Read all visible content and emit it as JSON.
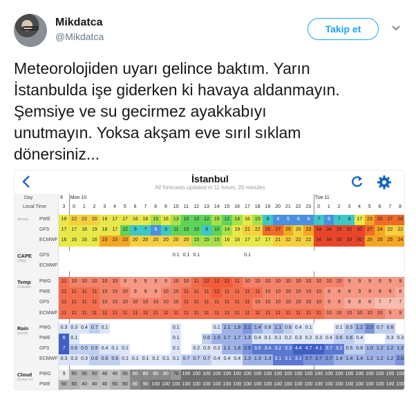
{
  "user": {
    "name": "Mikdatca",
    "handle": "@Mikdatca"
  },
  "follow_label": "Takip et",
  "tweet_lines": [
    "Meteorolojiden uyarı gelince baktım. Yarın",
    "İstanbulda işe giderken ki havaya aldanmayın.",
    "Şemsiye ve su gecirmez ayakkabıyı",
    "unutmayın. Yoksa akşam eve sırıl sıklam",
    "dönersiniz..."
  ],
  "forecast": {
    "title": "İstanbul",
    "subtitle": "All forecasts updated in 11 hours, 20 minutes",
    "day_label": "Day",
    "time_label": "Local Time",
    "days": [
      {
        "col": 0,
        "label": "9"
      },
      {
        "col": 1,
        "label": "Mon 10"
      },
      {
        "col": 25,
        "label": "Tue 11"
      }
    ],
    "hours": [
      "3",
      "0",
      "1",
      "2",
      "3",
      "4",
      "5",
      "6",
      "7",
      "8",
      "9",
      "10",
      "11",
      "12",
      "13",
      "14",
      "15",
      "16",
      "17",
      "18",
      "19",
      "20",
      "21",
      "22",
      "23",
      "0",
      "1",
      "2",
      "3",
      "4",
      "5",
      "6",
      "7",
      "8"
    ],
    "groups": [
      {
        "name": "",
        "unit": "(Knots)",
        "models": [
          "PWE",
          "GFS",
          "ECMWF"
        ]
      },
      {
        "name": "CAPE",
        "unit": "(J/kg)",
        "models": [
          "GFS",
          "ECMWF"
        ]
      },
      {
        "name": "Temp",
        "unit": "(Celsius)",
        "models": [
          "PWG",
          "PWE",
          "GFS",
          "ECMWF"
        ]
      },
      {
        "name": "Rain",
        "unit": "(mm/h)",
        "models": [
          "PWG",
          "PWE",
          "GFS",
          "ECMWF"
        ]
      },
      {
        "name": "Cloud",
        "unit": "(Cover %)",
        "models": [
          "PWG",
          "PWE",
          "GFS",
          "ECMWF"
        ]
      }
    ],
    "rows": {
      "wind_pwe": [
        "19",
        "22",
        "22",
        "20",
        "19",
        "17",
        "17",
        "16",
        "16",
        "15",
        "16",
        "13",
        "10",
        "10",
        "12",
        "15",
        "12",
        "14",
        "16",
        "15",
        "8",
        "4",
        "5",
        "6",
        "6",
        "7",
        "6",
        "7",
        "8",
        "17",
        "23",
        "26",
        "27",
        "28"
      ],
      "wind_gfs": [
        "17",
        "17",
        "18",
        "19",
        "18",
        "17",
        "12",
        "9",
        "7",
        "6",
        "9",
        "11",
        "10",
        "10",
        "9",
        "10",
        "14",
        "19",
        "21",
        "22",
        "26",
        "27",
        "25",
        "20",
        "23",
        "34",
        "34",
        "33",
        "32",
        "30",
        "27",
        "24",
        "22",
        "22"
      ],
      "wind_ecmwf": [
        "16",
        "16",
        "16",
        "16",
        "23",
        "23",
        "23",
        "20",
        "20",
        "20",
        "20",
        "20",
        "20",
        "15",
        "15",
        "15",
        "16",
        "16",
        "17",
        "17",
        "17",
        "21",
        "22",
        "22",
        "22",
        "34",
        "34",
        "33",
        "33",
        "30",
        "25",
        "25",
        "25",
        "24"
      ],
      "cape_gfs": [
        "",
        "",
        "",
        "",
        "",
        "",
        "",
        "",
        "",
        "",
        "",
        "0.1",
        "0.1",
        "0.1",
        "",
        "",
        "",
        "",
        "0.1",
        "",
        "",
        "",
        "",
        "",
        "",
        "",
        "",
        "",
        "",
        "",
        "",
        "",
        "",
        ""
      ],
      "cape_ecmwf": [
        "",
        "",
        "",
        "",
        "",
        "",
        "",
        "",
        "",
        "",
        "",
        "",
        "",
        "",
        "",
        "",
        "",
        "",
        "",
        "",
        "",
        "",
        "",
        "",
        "",
        "",
        "",
        "",
        "",
        "",
        "",
        "",
        "",
        ""
      ],
      "temp_pwg": [
        "11",
        "10",
        "10",
        "10",
        "10",
        "10",
        "9",
        "9",
        "9",
        "9",
        "9",
        "10",
        "10",
        "11",
        "12",
        "12",
        "12",
        "11",
        "10",
        "10",
        "10",
        "10",
        "10",
        "10",
        "10",
        "10",
        "10",
        "10",
        "9",
        "9",
        "9",
        "9",
        "9",
        "9"
      ],
      "temp_pwe": [
        "11",
        "11",
        "11",
        "11",
        "10",
        "10",
        "10",
        "9",
        "9",
        "9",
        "10",
        "10",
        "11",
        "11",
        "11",
        "12",
        "11",
        "11",
        "11",
        "11",
        "10",
        "10",
        "10",
        "10",
        "10",
        "10",
        "9",
        "9",
        "9",
        "9",
        "9",
        "9",
        "9",
        "8"
      ],
      "temp_gfs": [
        "11",
        "11",
        "11",
        "11",
        "10",
        "10",
        "10",
        "10",
        "10",
        "10",
        "10",
        "10",
        "11",
        "11",
        "11",
        "11",
        "11",
        "11",
        "11",
        "10",
        "10",
        "10",
        "10",
        "10",
        "10",
        "10",
        "9",
        "9",
        "8",
        "8",
        "8",
        "7",
        "7",
        "7"
      ],
      "temp_ecmwf": [
        "11",
        "11",
        "11",
        "11",
        "11",
        "11",
        "11",
        "11",
        "11",
        "11",
        "11",
        "11",
        "11",
        "11",
        "11",
        "11",
        "11",
        "11",
        "11",
        "11",
        "11",
        "11",
        "11",
        "11",
        "11",
        "11",
        "10",
        "10",
        "10",
        "10",
        "10",
        "10",
        "9",
        "9"
      ],
      "rain_pwg": [
        "0.3",
        "0.3",
        "0.4",
        "0.7",
        "0.1",
        "",
        "",
        "",
        "",
        "",
        "",
        "0.1",
        "",
        "",
        "",
        "0.1",
        "1.1",
        "1.8",
        "2.1",
        "1.4",
        "0.8",
        "1.1",
        "0.6",
        "0.4",
        "0.1",
        "",
        "",
        "0.1",
        "0.5",
        "1.2",
        "2.0",
        "0.7",
        "0.6",
        ""
      ],
      "rain_pwe": [
        "6",
        "0.1",
        "",
        "",
        "",
        "",
        "",
        "",
        "",
        "",
        "",
        "0.1",
        "",
        "",
        "0.6",
        "1.5",
        "1.7",
        "1.7",
        "1.3",
        "0.4",
        "0.1",
        "0.1",
        "0.2",
        "0.3",
        "0.2",
        "0.3",
        "0.4",
        "0.6",
        "0.6",
        "0.4",
        "",
        "",
        "0.3",
        "0.3"
      ],
      "rain_gfs": [
        "7",
        "0.6",
        "0.5",
        "0.5",
        "0.4",
        "0.1",
        "0.1",
        "",
        "",
        "",
        "",
        "0.1",
        "",
        "0.2",
        "0.3",
        "0.2",
        "1.1",
        "1.8",
        "2.9",
        "3.5",
        "3.4",
        "3.2",
        "3.3",
        "4.4",
        "4.7",
        "4.1",
        "3.7",
        "3.2",
        "0.5",
        "0.8",
        "1.0",
        "1.2",
        "1.2",
        "1.2"
      ],
      "rain_ecmwf": [
        "0.3",
        "0.3",
        "0.3",
        "0.6",
        "0.6",
        "0.6",
        "0.1",
        "0.1",
        "0.1",
        "0.1",
        "0.1",
        "0.1",
        "0.7",
        "0.7",
        "0.7",
        "0.4",
        "0.4",
        "0.4",
        "1.3",
        "1.3",
        "1.3",
        "3.1",
        "3.1",
        "3.1",
        "2.7",
        "2.7",
        "2.7",
        "1.4",
        "1.4",
        "1.4",
        "1.2",
        "1.2",
        "1.2",
        "2.0"
      ],
      "cloud_pwg": [
        "9",
        "50",
        "50",
        "50",
        "40",
        "40",
        "50",
        "80",
        "80",
        "80",
        "80",
        "70",
        "100",
        "100",
        "100",
        "100",
        "100",
        "100",
        "100",
        "100",
        "100",
        "100",
        "100",
        "100",
        "100",
        "100",
        "100",
        "100",
        "100",
        "100",
        "100",
        "100",
        "100",
        "100"
      ],
      "cloud_pwe": [
        "50",
        "50",
        "40",
        "40",
        "40",
        "50",
        "50",
        "80",
        "90",
        "100",
        "100",
        "100",
        "100",
        "100",
        "100",
        "100",
        "100",
        "100",
        "100",
        "100",
        "100",
        "100",
        "100",
        "100",
        "100",
        "100",
        "100",
        "100",
        "100",
        "100",
        "100",
        "100",
        "100",
        "100"
      ],
      "cloud_gfs": [
        "0",
        "100",
        "100",
        "100",
        "90",
        "80",
        "80",
        "70",
        "50",
        "40",
        "40",
        "20",
        "30",
        "40",
        "60",
        "70",
        "100",
        "100",
        "100",
        "100",
        "100",
        "100",
        "100",
        "100",
        "100",
        "100",
        "100",
        "100",
        "100",
        "100",
        "100",
        "100",
        "100",
        "100"
      ],
      "cloud_ecmwf": [
        "100",
        "100",
        "100",
        "100",
        "80",
        "80",
        "80",
        "50",
        "50",
        "60",
        "60",
        "60",
        "80",
        "100",
        "100",
        "100",
        "100",
        "100",
        "100",
        "100",
        "100",
        "100",
        "100",
        "100",
        "100",
        "100",
        "100",
        "100",
        "100",
        "100",
        "100",
        "100",
        "100",
        "100"
      ]
    },
    "colors": {
      "accent": "#1da1f2",
      "header_blue": "#1565c0"
    }
  }
}
